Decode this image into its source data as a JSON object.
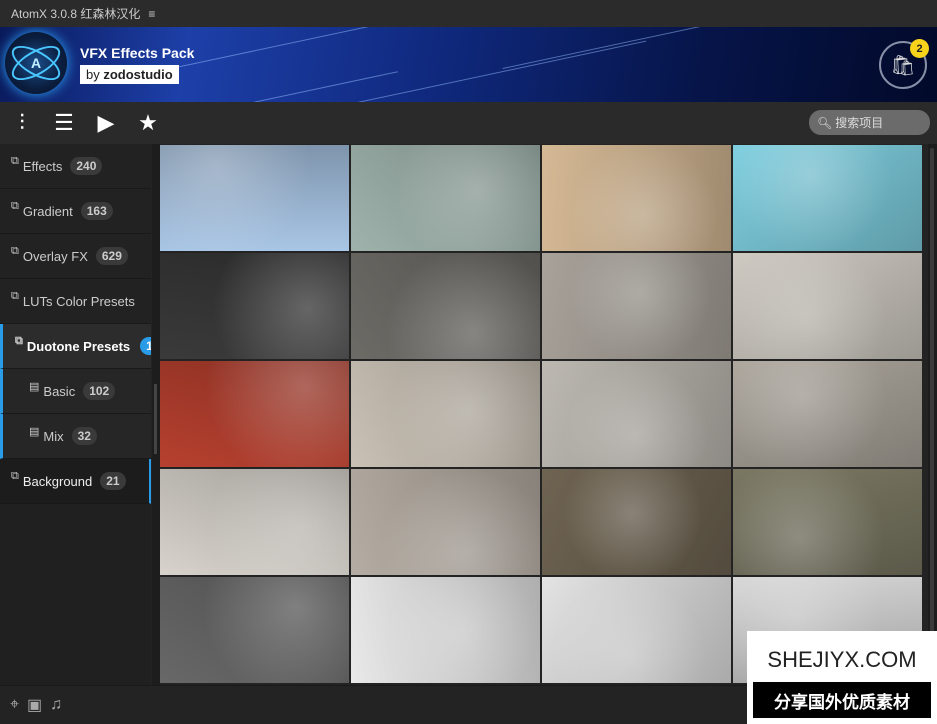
{
  "titlebar": {
    "app": "AtomX 3.0.8 红森林汉化",
    "menu_icon": "≡"
  },
  "banner": {
    "title": "VFX Effects Pack",
    "by": "by",
    "author": "zodostudio",
    "cart_count": "2"
  },
  "toolbar": {
    "search_placeholder": "搜索项目"
  },
  "sidebar": {
    "items": [
      {
        "label": "Effects",
        "count": "240"
      },
      {
        "label": "Gradient",
        "count": "163"
      },
      {
        "label": "Overlay FX",
        "count": "629"
      },
      {
        "label": "LUTs Color Presets",
        "count": ""
      },
      {
        "label": "Duotone Presets",
        "count": "1"
      },
      {
        "label": "Basic",
        "count": "102"
      },
      {
        "label": "Mix",
        "count": "32"
      },
      {
        "label": "Background",
        "count": "21"
      }
    ]
  },
  "tiles": [
    "#a9c6e6",
    "#9fb3ac",
    "#d5b995",
    "#7fcfe0",
    "#3a3a3a",
    "#6d6b66",
    "#a8a29a",
    "#cfcac2",
    "#b7402f",
    "#c9c1b5",
    "#bdb9b2",
    "#aba59b",
    "#d8d3cc",
    "#b5ada3",
    "#6f6452",
    "#7a7762",
    "#676867",
    "#e9e9e9",
    "#e3e3e3",
    "#d6d6d6"
  ],
  "watermark": {
    "site": "SHEJIYX.COM",
    "tagline": "分享国外优质素材"
  }
}
